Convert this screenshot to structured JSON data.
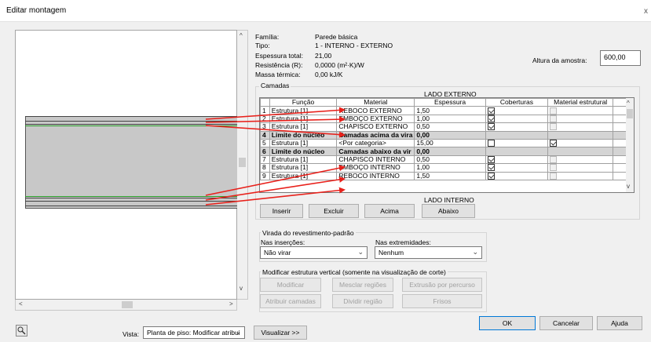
{
  "window": {
    "title": "Editar montagem",
    "close": "x"
  },
  "props": [
    {
      "label": "Família:",
      "value": "Parede básica"
    },
    {
      "label": "Tipo:",
      "value": "1 - INTERNO - EXTERNO"
    },
    {
      "label": "Espessura total:",
      "value": "21,00"
    },
    {
      "label": "Resistência (R):",
      "value": "0,0000 (m²·K)/W"
    },
    {
      "label": "Massa térmica:",
      "value": "0,00 kJ/K"
    }
  ],
  "sample_height": {
    "label": "Altura da amostra:",
    "value": "600,00"
  },
  "layers": {
    "group_label": "Camadas",
    "top_label": "LADO EXTERNO",
    "bottom_label": "LADO INTERNO",
    "columns": [
      "Função",
      "Material",
      "Espessura",
      "Coberturas",
      "Material estrutural"
    ],
    "rows": [
      {
        "n": "1",
        "func": "Estrutura [1]",
        "mat": "REBOCO EXTERNO",
        "esp": "1,50",
        "cob": true,
        "est": false,
        "bold": false
      },
      {
        "n": "2",
        "func": "Estrutura [1]",
        "mat": "EMBOÇO EXTERNO",
        "esp": "1,00",
        "cob": true,
        "est": false,
        "bold": false
      },
      {
        "n": "3",
        "func": "Estrutura [1]",
        "mat": "CHAPISCO EXTERNO",
        "esp": "0,50",
        "cob": true,
        "est": false,
        "bold": false
      },
      {
        "n": "4",
        "func": "Limite do núcleo",
        "mat": "Camadas acima da vira",
        "esp": "0,00",
        "cob": null,
        "est": null,
        "bold": true
      },
      {
        "n": "5",
        "func": "Estrutura [1]",
        "mat": "<Por categoria>",
        "esp": "15,00",
        "cob": false,
        "est": true,
        "bold": false
      },
      {
        "n": "6",
        "func": "Limite do núcleo",
        "mat": "Camadas abaixo da vir",
        "esp": "0,00",
        "cob": null,
        "est": null,
        "bold": true
      },
      {
        "n": "7",
        "func": "Estrutura [1]",
        "mat": "CHAPISCO INTERNO",
        "esp": "0,50",
        "cob": true,
        "est": false,
        "bold": false
      },
      {
        "n": "8",
        "func": "Estrutura [1]",
        "mat": "EMBOÇO INTERNO",
        "esp": "1,00",
        "cob": true,
        "est": false,
        "bold": false
      },
      {
        "n": "9",
        "func": "Estrutura [1]",
        "mat": "REBOCO INTERNO",
        "esp": "1,50",
        "cob": true,
        "est": false,
        "bold": false
      }
    ],
    "buttons": {
      "insert": "Inserir",
      "delete": "Excluir",
      "up": "Acima",
      "down": "Abaixo"
    }
  },
  "wrapping": {
    "group_label": "Virada do revestimento-padrão",
    "inserts_label": "Nas inserções:",
    "inserts_value": "Não virar",
    "ends_label": "Nas extremidades:",
    "ends_value": "Nenhum"
  },
  "vertical": {
    "group_label": "Modificar estrutura vertical (somente na visualização de corte)",
    "buttons": [
      "Modificar",
      "Mesclar regiões",
      "Extrusão por percurso",
      "Atribuir camadas",
      "Dividir região",
      "Frisos"
    ]
  },
  "footer": {
    "view_label": "Vista:",
    "view_value": "Planta de piso: Modificar atribui",
    "preview_button": "Visualizar >>",
    "ok": "OK",
    "cancel": "Cancelar",
    "help": "Ajuda"
  },
  "icons": {
    "scroll_up": "^",
    "scroll_down": "v",
    "scroll_left": "<",
    "scroll_right": ">",
    "chevron": "⌄"
  },
  "colors": {
    "arrow": "#e8211b",
    "green_line": "#2aa02a",
    "focus_border": "#0078d7"
  }
}
